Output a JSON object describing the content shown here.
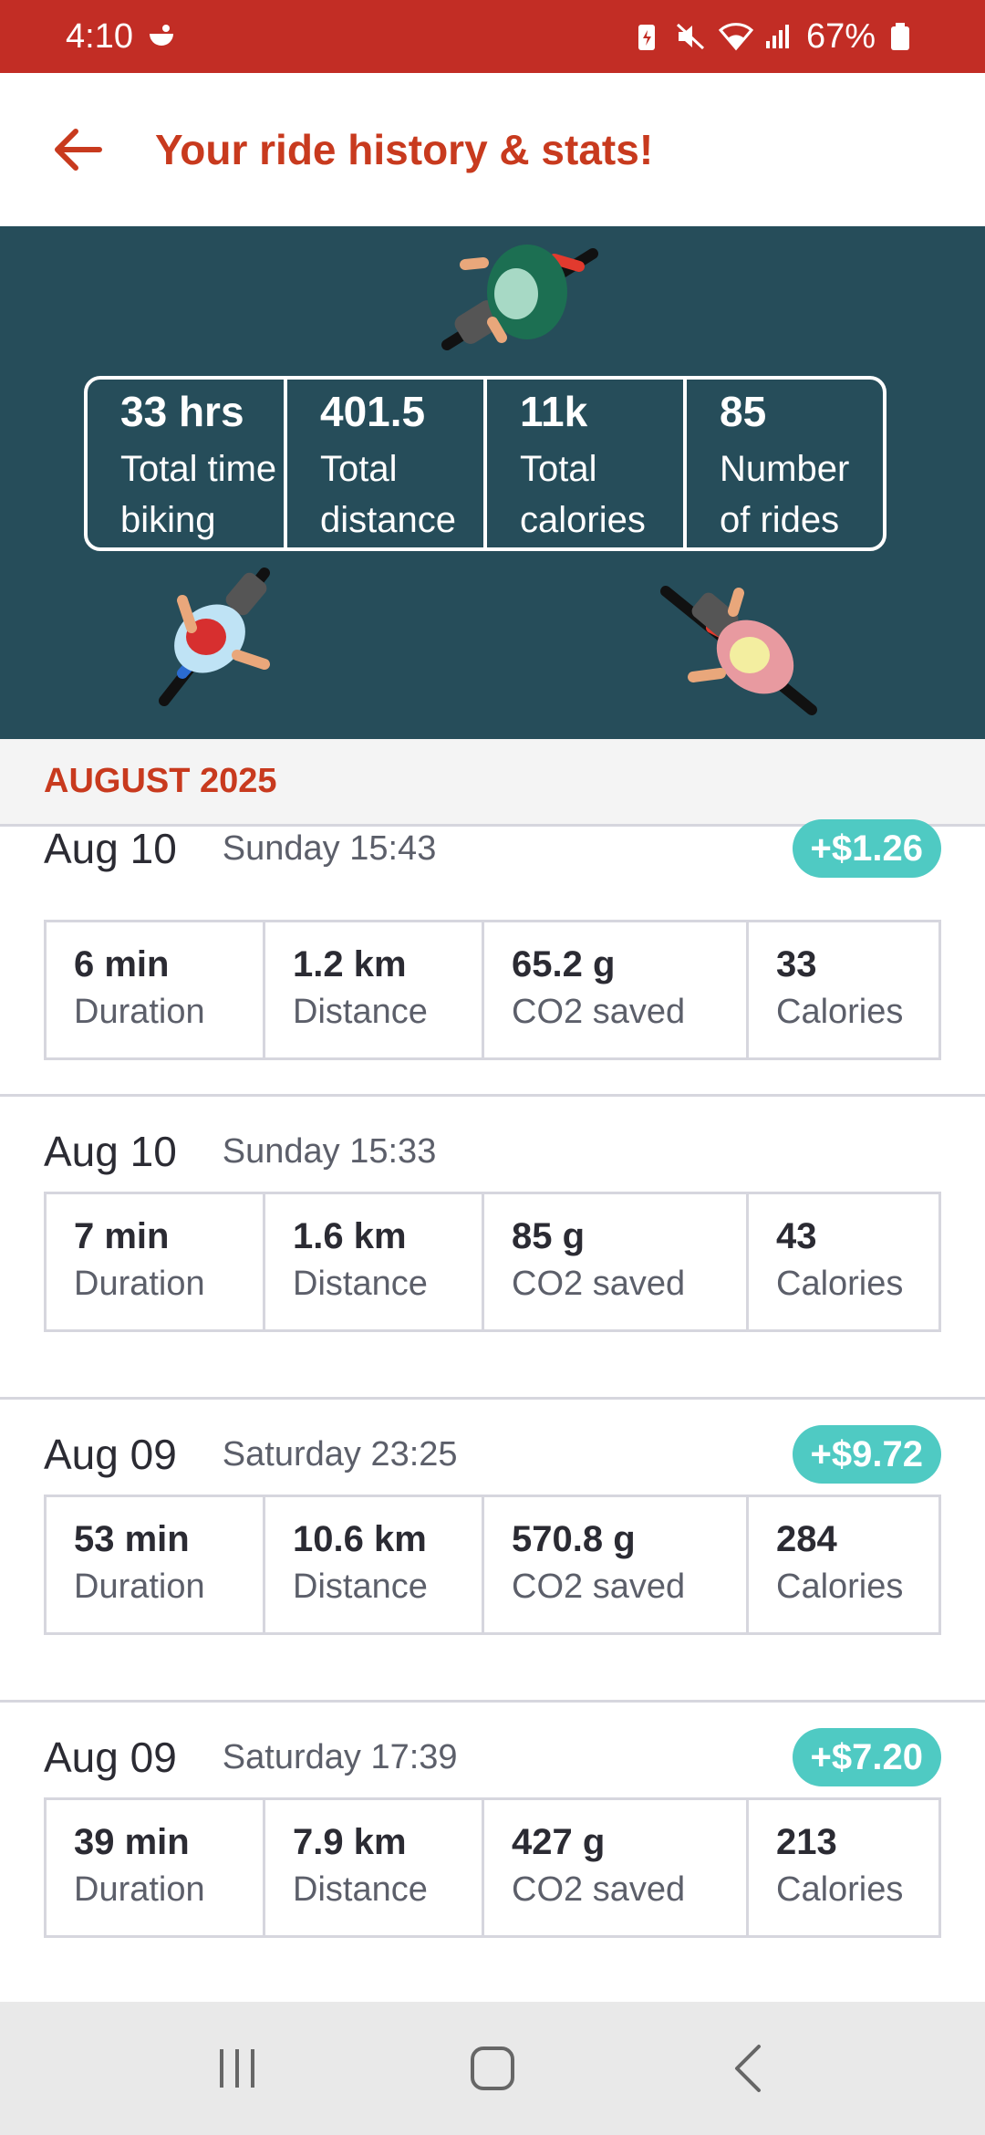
{
  "status_bar": {
    "time": "4:10",
    "battery": "67%",
    "icons": [
      "app-notification-icon",
      "battery-saver-icon",
      "mute-icon",
      "wifi-icon",
      "signal-icon",
      "battery-icon"
    ]
  },
  "header": {
    "back_icon": "arrow-left-icon",
    "title": "Your ride history & stats!",
    "accent_color": "#c83a1e"
  },
  "hero": {
    "background_color": "#264d5a",
    "stats": [
      {
        "value": "33 hrs",
        "label": "Total time\nbiking"
      },
      {
        "value": "401.5",
        "label": "Total\ndistance"
      },
      {
        "value": "11k",
        "label": "Total\ncalories"
      },
      {
        "value": "85",
        "label": "Number\nof rides"
      }
    ]
  },
  "month": {
    "label": "AUGUST 2025"
  },
  "rides": [
    {
      "date": "Aug 10",
      "time": "Sunday 15:43",
      "reward": "+$1.26",
      "metrics": [
        {
          "value": "6 min",
          "label": "Duration"
        },
        {
          "value": "1.2 km",
          "label": "Distance"
        },
        {
          "value": "65.2 g",
          "label": "CO2 saved"
        },
        {
          "value": "33",
          "label": "Calories"
        }
      ]
    },
    {
      "date": "Aug 10",
      "time": "Sunday 15:33",
      "reward": "",
      "metrics": [
        {
          "value": "7 min",
          "label": "Duration"
        },
        {
          "value": "1.6 km",
          "label": "Distance"
        },
        {
          "value": "85 g",
          "label": "CO2 saved"
        },
        {
          "value": "43",
          "label": "Calories"
        }
      ]
    },
    {
      "date": "Aug 09",
      "time": "Saturday 23:25",
      "reward": "+$9.72",
      "metrics": [
        {
          "value": "53 min",
          "label": "Duration"
        },
        {
          "value": "10.6 km",
          "label": "Distance"
        },
        {
          "value": "570.8 g",
          "label": "CO2 saved"
        },
        {
          "value": "284",
          "label": "Calories"
        }
      ]
    },
    {
      "date": "Aug 09",
      "time": "Saturday 17:39",
      "reward": "+$7.20",
      "metrics": [
        {
          "value": "39 min",
          "label": "Duration"
        },
        {
          "value": "7.9 km",
          "label": "Distance"
        },
        {
          "value": "427 g",
          "label": "CO2 saved"
        },
        {
          "value": "213",
          "label": "Calories"
        }
      ]
    }
  ],
  "nav_bar": {
    "buttons": [
      "recent-apps-icon",
      "home-icon",
      "back-icon"
    ]
  },
  "colors": {
    "status_bar": "#c22d25",
    "reward_badge": "#4fcac3"
  }
}
